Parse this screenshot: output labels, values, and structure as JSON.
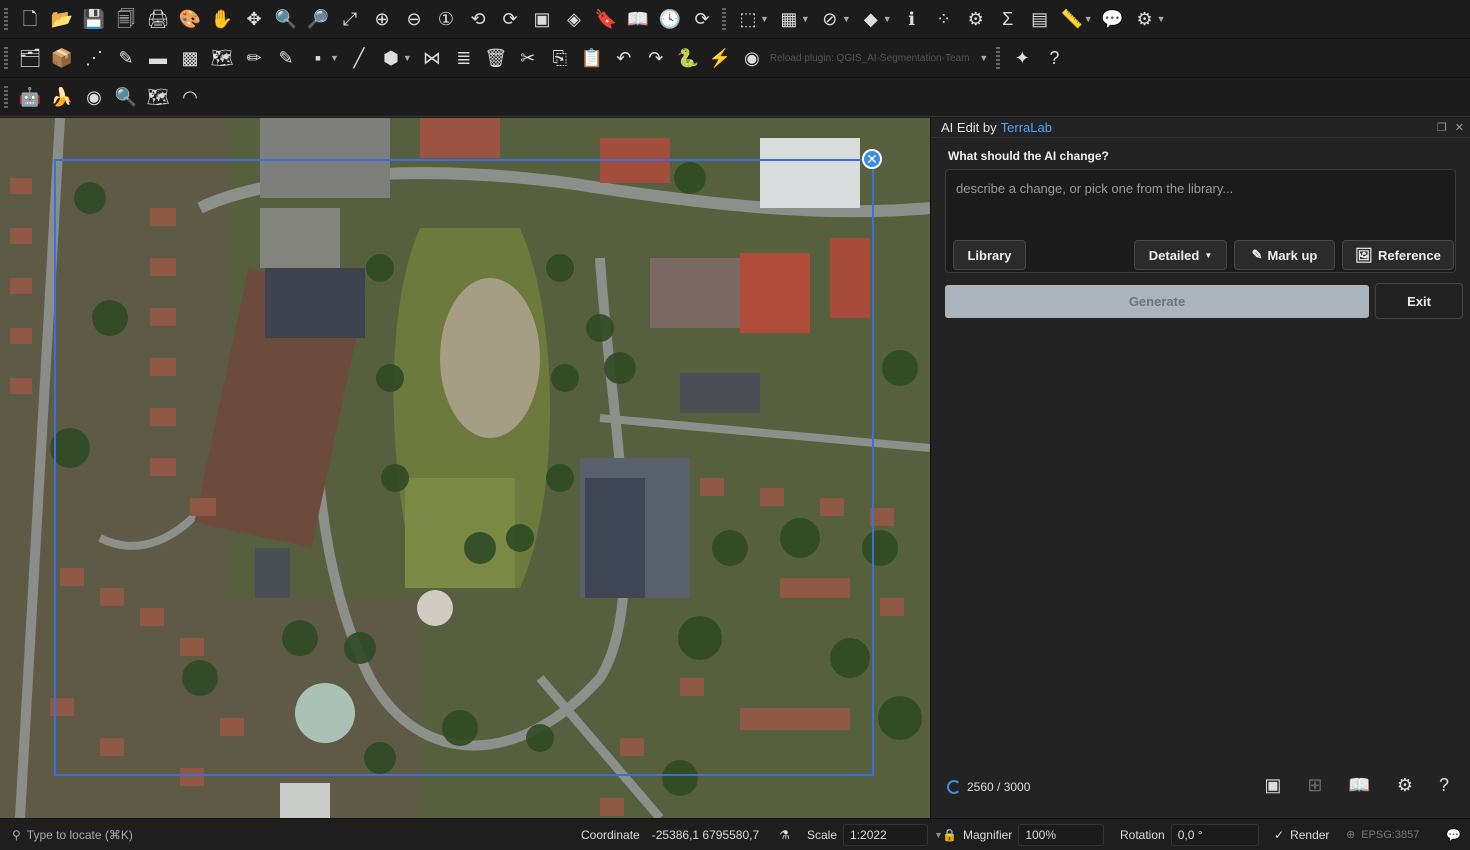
{
  "toolbars": {
    "row1": [
      {
        "name": "new-project-icon",
        "glyph": "🗋"
      },
      {
        "name": "open-project-icon",
        "glyph": "📂"
      },
      {
        "name": "save-project-icon",
        "glyph": "💾"
      },
      {
        "name": "save-as-icon",
        "glyph": "🗐"
      },
      {
        "name": "print-layout-icon",
        "glyph": "🖨"
      },
      {
        "name": "style-manager-icon",
        "glyph": "🎨"
      },
      {
        "name": "pan-icon",
        "glyph": "✋"
      },
      {
        "name": "pan-to-selection-icon",
        "glyph": "✥"
      },
      {
        "name": "zoom-in-icon",
        "glyph": "🔍"
      },
      {
        "name": "zoom-out-icon",
        "glyph": "🔎"
      },
      {
        "name": "zoom-full-icon",
        "glyph": "⤢"
      },
      {
        "name": "zoom-layer-icon",
        "glyph": "⊕"
      },
      {
        "name": "zoom-selection-icon",
        "glyph": "⊖"
      },
      {
        "name": "zoom-native-icon",
        "glyph": "①"
      },
      {
        "name": "zoom-last-icon",
        "glyph": "⟲"
      },
      {
        "name": "zoom-next-icon",
        "glyph": "⟳"
      },
      {
        "name": "new-map-view-icon",
        "glyph": "▣"
      },
      {
        "name": "new-3d-view-icon",
        "glyph": "◈"
      },
      {
        "name": "bookmark-icon",
        "glyph": "🔖"
      },
      {
        "name": "show-bookmarks-icon",
        "glyph": "📖"
      },
      {
        "name": "temporal-icon",
        "glyph": "🕓"
      },
      {
        "name": "refresh-icon",
        "glyph": "⟳"
      }
    ],
    "row1b": [
      {
        "name": "select-features-icon",
        "glyph": "⬚"
      },
      {
        "name": "attribute-table-icon",
        "glyph": "▦"
      },
      {
        "name": "deselect-icon",
        "glyph": "⊘"
      },
      {
        "name": "select-location-icon",
        "glyph": "◆"
      },
      {
        "name": "identify-icon",
        "glyph": "ℹ"
      },
      {
        "name": "processing-toolbox-icon",
        "glyph": "⁘"
      },
      {
        "name": "settings-icon",
        "glyph": "⚙"
      },
      {
        "name": "field-calculator-icon",
        "glyph": "Σ"
      },
      {
        "name": "statistics-icon",
        "glyph": "▤"
      },
      {
        "name": "measure-icon",
        "glyph": "📏"
      },
      {
        "name": "map-tips-icon",
        "glyph": "💬"
      },
      {
        "name": "annotation-icon",
        "glyph": "⚙"
      }
    ],
    "row2": [
      {
        "name": "data-source-manager-icon",
        "glyph": "🗂"
      },
      {
        "name": "new-geopackage-icon",
        "glyph": "📦"
      },
      {
        "name": "new-shapefile-icon",
        "glyph": "⋰"
      },
      {
        "name": "new-temp-layer-icon",
        "glyph": "✎"
      },
      {
        "name": "add-raster-icon",
        "glyph": "▬"
      },
      {
        "name": "add-mesh-icon",
        "glyph": "▩"
      },
      {
        "name": "add-vector-icon",
        "glyph": "🗺"
      },
      {
        "name": "edit-pencil-icon",
        "glyph": "✏"
      },
      {
        "name": "toggle-editing-icon",
        "glyph": "✎"
      },
      {
        "name": "save-edits-icon",
        "glyph": "▪"
      },
      {
        "name": "digitize-icon",
        "glyph": "╱"
      },
      {
        "name": "add-feature-icon",
        "glyph": "⬢"
      },
      {
        "name": "vertex-tool-icon",
        "glyph": "⋈"
      },
      {
        "name": "modify-attributes-icon",
        "glyph": "≣"
      },
      {
        "name": "delete-selected-icon",
        "glyph": "🗑"
      },
      {
        "name": "cut-features-icon",
        "glyph": "✂"
      },
      {
        "name": "copy-features-icon",
        "glyph": "⎘"
      },
      {
        "name": "paste-features-icon",
        "glyph": "📋"
      },
      {
        "name": "undo-icon",
        "glyph": "↶"
      },
      {
        "name": "redo-icon",
        "glyph": "↷"
      },
      {
        "name": "python-console-icon",
        "glyph": "🐍"
      },
      {
        "name": "plugin-icon",
        "glyph": "⚡"
      },
      {
        "name": "reload-plugin-icon",
        "glyph": "◉"
      }
    ],
    "reload_text": "Reload plugin: QGIS_AI-Segmentation-Team",
    "row2b": [
      {
        "name": "plugin-tool-icon",
        "glyph": "✦"
      },
      {
        "name": "help-icon",
        "glyph": "?"
      }
    ],
    "row3": [
      {
        "name": "ai-robot-icon",
        "glyph": "🤖"
      },
      {
        "name": "banana-icon",
        "glyph": "🍌"
      },
      {
        "name": "eye-plugin-icon",
        "glyph": "◉"
      },
      {
        "name": "zoom-plugin-icon",
        "glyph": "🔍"
      },
      {
        "name": "segment-plugin-icon",
        "glyph": "🗺"
      },
      {
        "name": "gauge-icon",
        "glyph": "◠"
      }
    ]
  },
  "colors": {
    "accent": "#4aa3ff",
    "generate_bg": "#a9b4bc",
    "selection": "#3b6fe0"
  },
  "panel": {
    "title": "AI Edit by",
    "brand": "TerraLab",
    "question": "What should the AI change?",
    "placeholder": "describe a change, or pick one from the library...",
    "library_label": "Library",
    "detail_label": "Detailed",
    "markup_label": "Mark up",
    "reference_label": "Reference",
    "generate_label": "Generate",
    "exit_label": "Exit",
    "progress": "2560 / 3000"
  },
  "status": {
    "locate_placeholder": "Type to locate (⌘K)",
    "coordinate_label": "Coordinate",
    "coordinate_value": "-25386,1  6795580,7",
    "scale_label": "Scale",
    "scale_value": "1:2022",
    "magnifier_label": "Magnifier",
    "magnifier_value": "100%",
    "rotation_label": "Rotation",
    "rotation_value": "0,0 °",
    "render_label": "Render",
    "crs_value": "EPSG:3857"
  }
}
